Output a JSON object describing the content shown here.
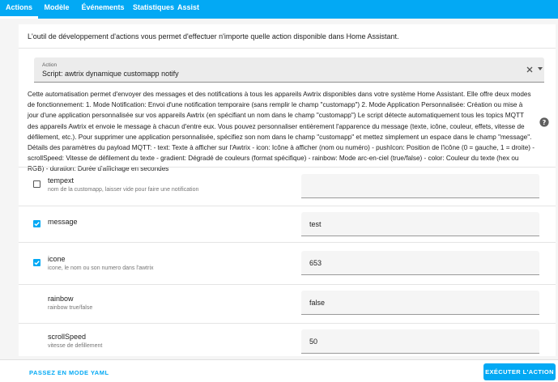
{
  "tabs": [
    {
      "label": "Actions",
      "active": true
    },
    {
      "label": "Modèle",
      "active": false
    },
    {
      "label": "Événements",
      "active": false
    },
    {
      "label": "Statistiques",
      "active": false
    },
    {
      "label": "Assist",
      "active": false
    }
  ],
  "intro": "L'outil de développement d'actions vous permet d'effectuer n'importe quelle action disponible dans Home Assistant.",
  "action_field": {
    "label": "Action",
    "value": "Script: awtrix dynamique customapp notify"
  },
  "description": "Cette automatisation permet d'envoyer des messages et des notifications à tous les appareils Awtrix disponibles dans votre système Home Assistant. Elle offre deux modes de fonctionnement: 1. Mode Notification: Envoi d'une notification temporaire (sans remplir le champ \"customapp\") 2. Mode Application Personnalisée: Création ou mise à jour d'une application personnalisée sur vos appareils Awtrix (en spécifiant un nom dans le champ \"customapp\") Le script détecte automatiquement tous les topics MQTT des appareils Awtrix et envoie le message à chacun d'entre eux. Vous pouvez personnaliser entièrement l'apparence du message (texte, icône, couleur, effets, vitesse de défilement, etc.). Pour supprimer une application personnalisée, spécifiez son nom dans le champ \"customapp\" et mettez simplement un espace dans le champ \"message\". Détails des paramètres du payload MQTT: - text: Texte à afficher sur l'Awtrix - icon: Icône à afficher (nom ou numéro) - pushIcon: Position de l'icône (0 = gauche, 1 = droite) - scrollSpeed: Vitesse de défilement du texte - gradient: Dégradé de couleurs (format spécifique) - rainbow: Mode arc-en-ciel (true/false) - color: Couleur du texte (hex ou RGB) - duration: Durée d'affichage en secondes",
  "fields": [
    {
      "name": "tempext",
      "desc": "nom de la customapp, laisser vide pour faire une notification",
      "value": "",
      "checkbox": true,
      "checked": false
    },
    {
      "name": "message",
      "desc": "",
      "value": "test",
      "checkbox": true,
      "checked": true
    },
    {
      "name": "icone",
      "desc": "icone, le nom ou son numero dans l'awtrix",
      "value": "653",
      "checkbox": true,
      "checked": true
    },
    {
      "name": "rainbow",
      "desc": "rainbow true/false",
      "value": "false",
      "checkbox": false,
      "checked": false
    },
    {
      "name": "scrollSpeed",
      "desc": "vitesse de defillement",
      "value": "50",
      "checkbox": false,
      "checked": false
    }
  ],
  "footer": {
    "yaml_label": "PASSEZ EN MODE YAML",
    "execute_label": "EXÉCUTER L'ACTION"
  },
  "colors": {
    "primary": "#03a9f4"
  },
  "icons": {
    "clear": "close-icon",
    "dropdown": "caret-down-icon",
    "help": "help-circle-icon",
    "check": "check-icon"
  }
}
